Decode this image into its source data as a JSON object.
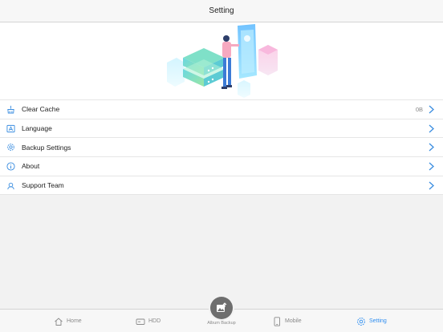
{
  "header": {
    "title": "Setting"
  },
  "settings": {
    "items": [
      {
        "label": "Clear Cache",
        "value": "0B",
        "icon": "broom-icon"
      },
      {
        "label": "Language",
        "value": "",
        "icon": "language-icon"
      },
      {
        "label": "Backup Settings",
        "value": "",
        "icon": "gear-icon"
      },
      {
        "label": "About",
        "value": "",
        "icon": "info-icon"
      },
      {
        "label": "Support Team",
        "value": "",
        "icon": "headset-icon"
      }
    ]
  },
  "tabbar": {
    "home": "Home",
    "hdd": "HDD",
    "album_backup": "Album Backup",
    "mobile": "Mobile",
    "setting": "Setting",
    "active": "setting"
  },
  "colors": {
    "accent": "#2f8ef0",
    "icon_blue": "#3a8de0"
  }
}
